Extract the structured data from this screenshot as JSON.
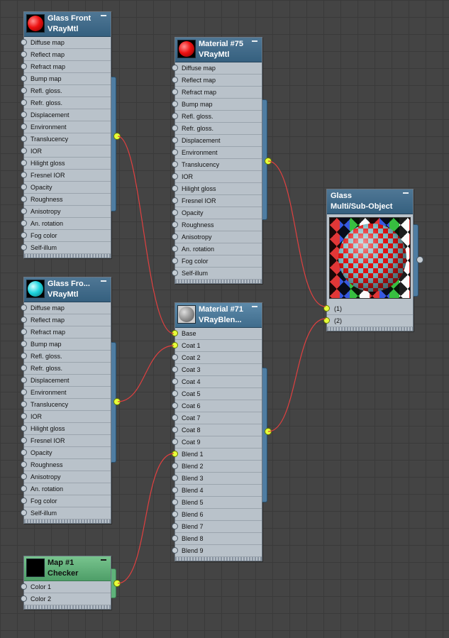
{
  "nodes": {
    "glass_front": {
      "title": "Glass Front",
      "type": "VRayMtl",
      "swatch": "red-sphere",
      "slots": [
        "Diffuse map",
        "Reflect map",
        "Refract map",
        "Bump map",
        "Refl. gloss.",
        "Refr. gloss.",
        "Displacement",
        "Environment",
        "Translucency",
        "IOR",
        "Hilight gloss",
        "Fresnel IOR",
        "Opacity",
        "Roughness",
        "Anisotropy",
        "An. rotation",
        "Fog color",
        "Self-illum"
      ]
    },
    "glass_front2": {
      "title": "Glass  Fro...",
      "type": "VRayMtl",
      "swatch": "cyan-sphere",
      "slots": [
        "Diffuse map",
        "Reflect map",
        "Refract map",
        "Bump map",
        "Refl. gloss.",
        "Refr. gloss.",
        "Displacement",
        "Environment",
        "Translucency",
        "IOR",
        "Hilight gloss",
        "Fresnel IOR",
        "Opacity",
        "Roughness",
        "Anisotropy",
        "An. rotation",
        "Fog color",
        "Self-illum"
      ]
    },
    "checker": {
      "title": "Map #1",
      "type": "Checker",
      "swatch": "checker-swatch",
      "slots": [
        "Color 1",
        "Color 2"
      ]
    },
    "material75": {
      "title": "Material #75",
      "type": "VRayMtl",
      "swatch": "red-sphere",
      "slots": [
        "Diffuse map",
        "Reflect map",
        "Refract map",
        "Bump map",
        "Refl. gloss.",
        "Refr. gloss.",
        "Displacement",
        "Environment",
        "Translucency",
        "IOR",
        "Hilight gloss",
        "Fresnel IOR",
        "Opacity",
        "Roughness",
        "Anisotropy",
        "An. rotation",
        "Fog color",
        "Self-illum"
      ]
    },
    "material71": {
      "title": "Material #71",
      "type": "VRayBlen...",
      "swatch": "grey-sphere",
      "slots": [
        "Base",
        "Coat 1",
        "Coat 2",
        "Coat 3",
        "Coat 4",
        "Coat 5",
        "Coat 6",
        "Coat 7",
        "Coat 8",
        "Coat 9",
        "Blend 1",
        "Blend 2",
        "Blend 3",
        "Blend 4",
        "Blend 5",
        "Blend 6",
        "Blend 7",
        "Blend 8",
        "Blend 9"
      ]
    },
    "glass_multi": {
      "title": "Glass",
      "type": "Multi/Sub-Object",
      "preview": "checker-ball-preview",
      "slots": [
        "(1)",
        "(2)"
      ]
    }
  },
  "connections": [
    {
      "from": "glass_front",
      "to": "material71",
      "slot": "Base"
    },
    {
      "from": "glass_front2",
      "to": "material71",
      "slot": "Coat 1"
    },
    {
      "from": "checker",
      "to": "material71",
      "slot": "Blend 1"
    },
    {
      "from": "material75",
      "to": "glass_multi",
      "slot": "(1)"
    },
    {
      "from": "material71",
      "to": "glass_multi",
      "slot": "(2)"
    }
  ],
  "colors": {
    "canvas": "#444444",
    "wire": "#e04040",
    "active_socket": "#e6ff3a",
    "header_blue": "#3f6c8c",
    "header_green": "#5fb27a"
  }
}
